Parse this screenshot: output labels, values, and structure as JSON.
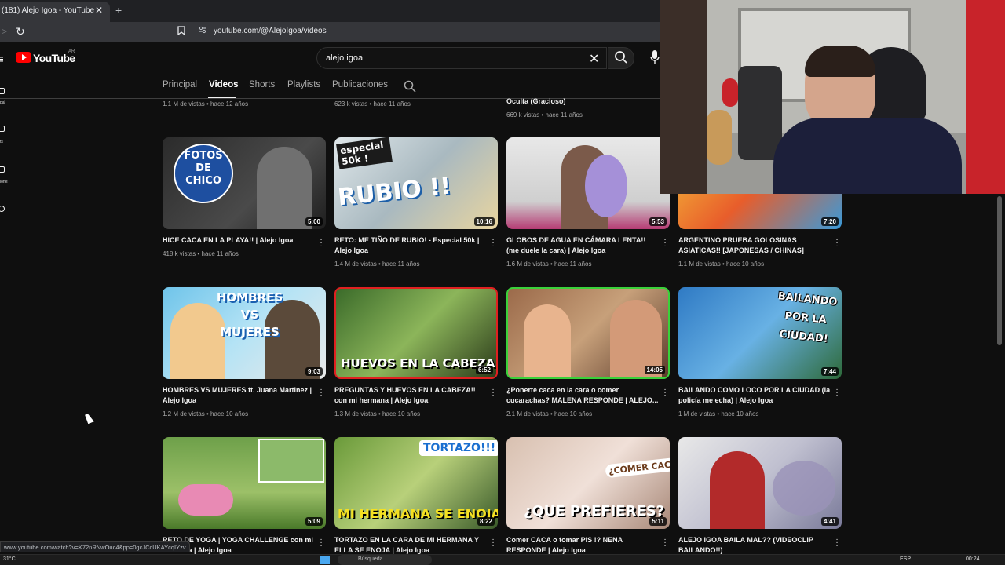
{
  "browser": {
    "tab_title": "(181) Alejo Igoa - YouTube",
    "tab_close": "✕",
    "new_tab": "+",
    "url": "youtube.com/@AlejoIgoa/videos",
    "status_url": "www.youtube.com/watch?v=K72nRNwOuc4&pp=0gcJCcUKAYcqIYzv"
  },
  "youtube": {
    "wordmark": "YouTube",
    "country": "AR",
    "search_value": "alejo igoa",
    "search_clear": "✕",
    "sidebar_labels": [
      "pal",
      "ts",
      "iones"
    ]
  },
  "tabs": [
    {
      "label": "Principal"
    },
    {
      "label": "Videos"
    },
    {
      "label": "Shorts"
    },
    {
      "label": "Playlists"
    },
    {
      "label": "Publicaciones"
    }
  ],
  "top_row_partial": [
    {
      "meta": "1.1 M de vistas • hace 12 años"
    },
    {
      "meta": "623 k vistas • hace 11 años"
    },
    {
      "title": "Oculta (Gracioso)",
      "meta": "669 k vistas • hace 11 años"
    }
  ],
  "videos": [
    {
      "title": "HICE CACA EN LA PLAYA!! | Alejo Igoa",
      "meta": "418 k vistas • hace 11 años",
      "duration": "5:00",
      "thumb_text": "FOTOS DE CHICO"
    },
    {
      "title": "RETO: ME TIÑO DE RUBIO! - Especial 50k | Alejo Igoa",
      "meta": "1.4 M de vistas • hace 11 años",
      "duration": "10:16",
      "thumb_text": "RUBIO !!",
      "thumb_text2": "especial 50k !"
    },
    {
      "title": "GLOBOS DE AGUA EN CÁMARA LENTA!! (me duele la cara) | Alejo Igoa",
      "meta": "1.6 M de vistas • hace 11 años",
      "duration": "5:53"
    },
    {
      "title": "ARGENTINO PRUEBA GOLOSINAS ASIATICAS!! [JAPONESAS / CHINAS]",
      "meta": "1.1 M de vistas • hace 10 años",
      "duration": "7:20"
    },
    {
      "title": "HOMBRES VS MUJERES ft. Juana Martinez | Alejo Igoa",
      "meta": "1.2 M de vistas • hace 10 años",
      "duration": "9:03",
      "thumb_text": "HOMBRES VS MUJERES"
    },
    {
      "title": "PREGUNTAS Y HUEVOS EN LA CABEZA!! con mi hermana | Alejo Igoa",
      "meta": "1.3 M de vistas • hace 10 años",
      "duration": "6:52",
      "thumb_text": "HUEVOS EN LA CABEZA!"
    },
    {
      "title": "¿Ponerte caca en la cara o comer cucarachas? MALENA RESPONDE | ALEJO...",
      "meta": "2.1 M de vistas • hace 10 años",
      "duration": "14:05"
    },
    {
      "title": "BAILANDO COMO LOCO POR LA CIUDAD (la policía me echa) | Alejo Igoa",
      "meta": "1 M de vistas • hace 10 años",
      "duration": "7:44",
      "thumb_text": "BAILANDO POR LA CIUDAD!"
    },
    {
      "title": "RETO DE YOGA | YOGA CHALLENGE con mi hermana | Alejo Igoa",
      "duration": "5:09"
    },
    {
      "title": "TORTAZO EN LA CARA DE MI HERMANA Y ELLA SE ENOJA | Alejo Igoa",
      "duration": "8:22",
      "thumb_text": "MI HERMANA SE ENOJA !!!",
      "thumb_text2": "TORTAZO!!!"
    },
    {
      "title": "Comer CACA o tomar PIS !? NENA RESPONDE | Alejo Igoa",
      "duration": "5:11",
      "thumb_text": "¿QUE PREFIERES?",
      "thumb_text2": "¿COMER CACA?"
    },
    {
      "title": "ALEJO IGOA BAILA MAL?? (VIDEOCLIP BAILANDO!!)",
      "duration": "4:41"
    }
  ],
  "taskbar": {
    "temp": "31°C",
    "search_placeholder": "Búsqueda",
    "lang": "ESP",
    "time": "00:24"
  },
  "colors": {
    "background": "#0f0f0f",
    "youtube_red": "#ff0000",
    "text": "#f1f1f1",
    "meta_text": "#aaaaaa"
  }
}
